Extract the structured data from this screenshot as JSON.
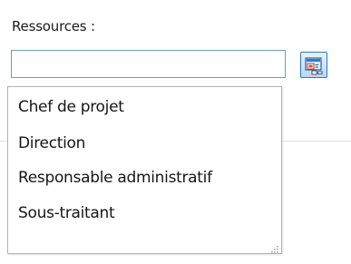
{
  "form": {
    "resources_label": "Ressources :",
    "resources_value": ""
  },
  "picker_button": {
    "icon": "resource-picker-icon"
  },
  "dropdown": {
    "items": [
      "Chef de projet",
      "Direction",
      "Responsable administratif",
      "Sous-traitant"
    ],
    "resize_icon": "resize-grip-icon"
  }
}
